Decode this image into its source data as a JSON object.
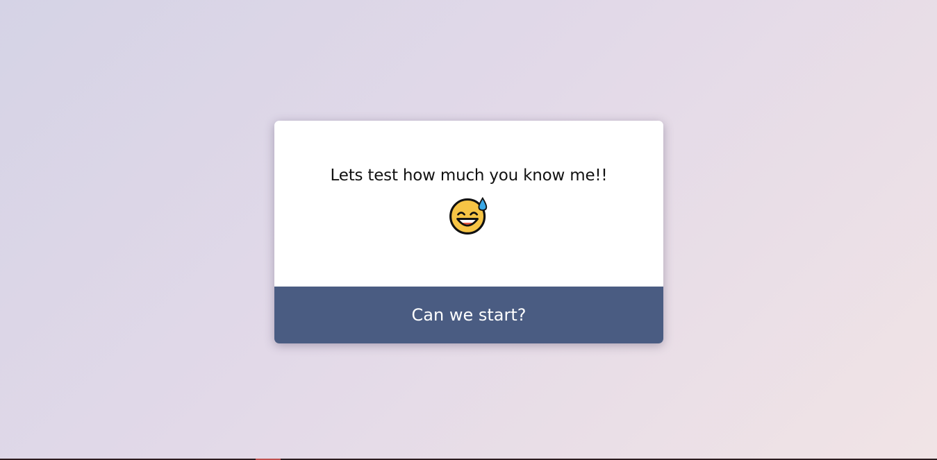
{
  "quiz_card": {
    "title": "Lets test how much you know me!!",
    "emoji_icon": "grinning-face-with-sweat-icon",
    "start_button_label": "Can we start?"
  },
  "colors": {
    "button_background": "#4a5c82",
    "card_background": "#ffffff",
    "page_gradient_start": "#d5d3e6",
    "page_gradient_end": "#f1e4e6"
  }
}
